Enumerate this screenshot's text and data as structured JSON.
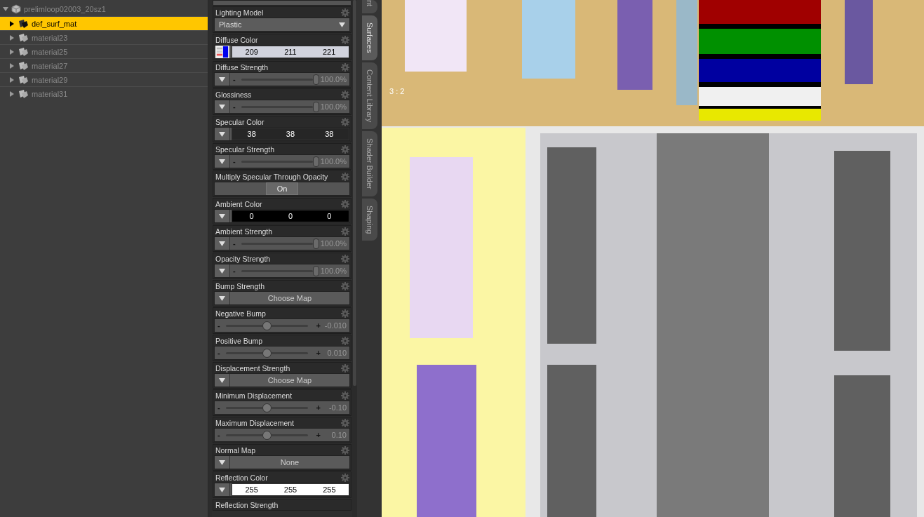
{
  "tree": {
    "label": "prelimloop02003_20sz1",
    "expanded": true,
    "children": [
      {
        "label": "def_surf_mat",
        "selected": true
      },
      {
        "label": "material23",
        "selected": false
      },
      {
        "label": "material25",
        "selected": false
      },
      {
        "label": "material27",
        "selected": false
      },
      {
        "label": "material29",
        "selected": false
      },
      {
        "label": "material31",
        "selected": false
      }
    ]
  },
  "properties": [
    {
      "kind": "dropdown",
      "label": "Lighting Model",
      "value": "Plastic"
    },
    {
      "kind": "color",
      "label": "Diffuse Color",
      "swatch": true,
      "values": [
        "209",
        "211",
        "221"
      ]
    },
    {
      "kind": "slider",
      "label": "Diffuse Strength",
      "minus_sign": "-",
      "level": 1,
      "reading": "100.0%"
    },
    {
      "kind": "slider",
      "label": "Glossiness",
      "minus_sign": "-",
      "level": 1,
      "reading": "100.0%"
    },
    {
      "kind": "color",
      "label": "Specular Color",
      "swatch": false,
      "values": [
        "38",
        "38",
        "38"
      ]
    },
    {
      "kind": "slider",
      "label": "Specular Strength",
      "minus_sign": "-",
      "level": 1,
      "reading": "100.0%"
    },
    {
      "kind": "toggle",
      "label": "Multiply Specular Through Opacity",
      "value": "On",
      "on": true
    },
    {
      "kind": "color",
      "label": "Ambient Color",
      "swatch": false,
      "values": [
        "0",
        "0",
        "0"
      ]
    },
    {
      "kind": "slider",
      "label": "Ambient Strength",
      "minus_sign": "-",
      "level": 1,
      "reading": "100.0%"
    },
    {
      "kind": "slider",
      "label": "Opacity Strength",
      "minus_sign": "-",
      "level": 1,
      "reading": "100.0%"
    },
    {
      "kind": "map",
      "label": "Bump Strength",
      "value": "Choose Map"
    },
    {
      "kind": "bipolar",
      "label": "Negative Bump",
      "minus_sign": "-",
      "plus_sign": "+",
      "level": 0.5,
      "reading": "-0.010"
    },
    {
      "kind": "bipolar",
      "label": "Positive Bump",
      "minus_sign": "-",
      "plus_sign": "+",
      "level": 0.5,
      "reading": "0.010"
    },
    {
      "kind": "map",
      "label": "Displacement Strength",
      "value": "Choose Map"
    },
    {
      "kind": "bipolar",
      "label": "Minimum Displacement",
      "minus_sign": "-",
      "plus_sign": "+",
      "level": 0.5,
      "reading": "-0.10"
    },
    {
      "kind": "bipolar",
      "label": "Maximum Displacement",
      "minus_sign": "-",
      "plus_sign": "+",
      "level": 0.5,
      "reading": "0.10"
    },
    {
      "kind": "map",
      "label": "Normal Map",
      "value": "None"
    },
    {
      "kind": "color",
      "label": "Reflection Color",
      "swatch": false,
      "values": [
        "255",
        "255",
        "255"
      ]
    },
    {
      "kind": "header",
      "label": "Reflection Strength"
    }
  ],
  "side_tabs": [
    {
      "label": "nt",
      "selected": false
    },
    {
      "label": "Surfaces",
      "selected": true
    },
    {
      "label": "Content Library",
      "selected": false
    },
    {
      "label": "Shader Builder",
      "selected": false
    },
    {
      "label": "Shaping",
      "selected": false
    }
  ],
  "viewport": {
    "aspect_label": "3 : 2"
  }
}
